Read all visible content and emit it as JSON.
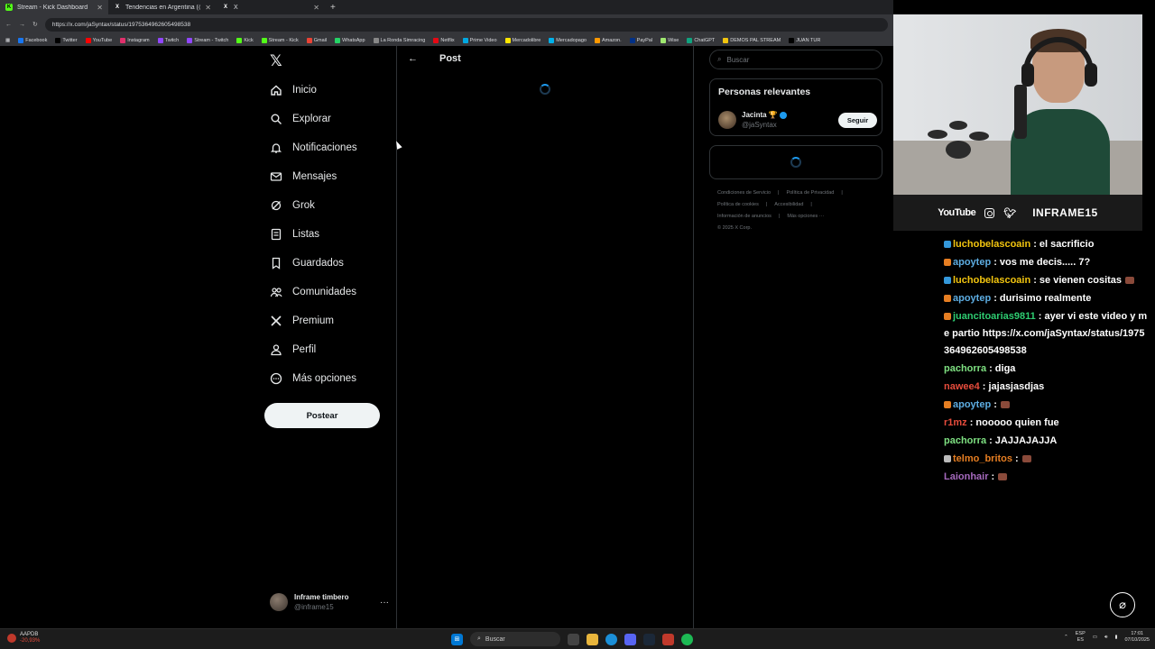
{
  "browser": {
    "tabs": [
      {
        "title": "Stream - Kick Dashboard",
        "fav_color": "#53fc18",
        "fav_glyph": "K"
      },
      {
        "title": "Tendencias en Argentina (@porq",
        "fav_color": "#000000",
        "fav_glyph": "X"
      },
      {
        "title": "X",
        "fav_color": "#000000",
        "fav_glyph": "X"
      }
    ],
    "url": "https://x.com/jaSyntax/status/1975364962605498538",
    "bookmarks": [
      {
        "label": "Facebook",
        "color": "#1877f2"
      },
      {
        "label": "Twitter",
        "color": "#000000"
      },
      {
        "label": "YouTube",
        "color": "#ff0000"
      },
      {
        "label": "Instagram",
        "color": "#e1306c"
      },
      {
        "label": "Twitch",
        "color": "#9146ff"
      },
      {
        "label": "Stream - Twitch",
        "color": "#9146ff"
      },
      {
        "label": "Kick",
        "color": "#53fc18"
      },
      {
        "label": "Stream - Kick",
        "color": "#53fc18"
      },
      {
        "label": "Gmail",
        "color": "#ea4335"
      },
      {
        "label": "WhatsApp",
        "color": "#25d366"
      },
      {
        "label": "La Ronda Simracing",
        "color": "#888888"
      },
      {
        "label": "Netflix",
        "color": "#e50914"
      },
      {
        "label": "Prime Video",
        "color": "#00a8e1"
      },
      {
        "label": "Mercadolibre",
        "color": "#ffe600"
      },
      {
        "label": "Mercadopago",
        "color": "#00b1ea"
      },
      {
        "label": "Amazon.",
        "color": "#ff9900"
      },
      {
        "label": "PayPal",
        "color": "#003087"
      },
      {
        "label": "Wise",
        "color": "#9fe870"
      },
      {
        "label": "ChatGPT",
        "color": "#10a37f"
      },
      {
        "label": "DEMOS PAL STREAM",
        "color": "#f1c40f"
      },
      {
        "label": "JUAN TUR",
        "color": "#000000"
      }
    ]
  },
  "x": {
    "logo": "𝕏",
    "nav": [
      {
        "label": "Inicio",
        "icon": "home-icon"
      },
      {
        "label": "Explorar",
        "icon": "search-icon"
      },
      {
        "label": "Notificaciones",
        "icon": "bell-icon"
      },
      {
        "label": "Mensajes",
        "icon": "mail-icon"
      },
      {
        "label": "Grok",
        "icon": "grok-icon"
      },
      {
        "label": "Listas",
        "icon": "list-icon"
      },
      {
        "label": "Guardados",
        "icon": "bookmark-icon"
      },
      {
        "label": "Comunidades",
        "icon": "communities-icon"
      },
      {
        "label": "Premium",
        "icon": "x-premium-icon"
      },
      {
        "label": "Perfil",
        "icon": "profile-icon"
      },
      {
        "label": "Más opciones",
        "icon": "more-icon"
      }
    ],
    "post_button": "Postear",
    "account": {
      "name": "Inframe timbero",
      "handle": "@inframe15",
      "more": "···"
    },
    "column": {
      "back": "←",
      "title": "Post"
    },
    "search_placeholder": "Buscar",
    "relevant": {
      "title": "Personas relevantes",
      "name": "Jacinta 🏆",
      "handle": "@jaSyntax",
      "follow": "Seguir"
    },
    "footer": [
      "Condiciones de Servicio",
      "|",
      "Política de Privacidad",
      "|",
      "Política de cookies",
      "|",
      "Accesibilidad",
      "|",
      "Información de anuncios",
      "|",
      "Más opciones ···",
      "© 2025 X Corp."
    ]
  },
  "overlay": {
    "social_youtube": "YouTube",
    "social_brand": "INFRAME15",
    "chat": [
      {
        "user": "luchobelascoain",
        "color": "#f1c40f",
        "badge": "#3498db",
        "text": ": el sacrificio",
        "emote": false
      },
      {
        "user": "apoytep",
        "color": "#5dade2",
        "badge": "#e67e22",
        "text": ": vos me decis..... 7?",
        "emote": false
      },
      {
        "user": "luchobelascoain",
        "color": "#f1c40f",
        "badge": "#3498db",
        "text": ": se vienen cositas",
        "emote": true
      },
      {
        "user": "apoytep",
        "color": "#5dade2",
        "badge": "#e67e22",
        "text": ": durisimo realmente",
        "emote": false
      },
      {
        "user": "juancitoarias9811",
        "color": "#2ecc71",
        "badge": "#e67e22",
        "text": ": ayer vi este video y me partio https://x.com/jaSyntax/status/1975364962605498538",
        "emote": false
      },
      {
        "user": "pachorra",
        "color": "#7ee081",
        "badge": "",
        "text": ": diga",
        "emote": false
      },
      {
        "user": "nawee4",
        "color": "#e74c3c",
        "badge": "",
        "text": ": jajasjasdjas",
        "emote": false
      },
      {
        "user": "apoytep",
        "color": "#5dade2",
        "badge": "#e67e22",
        "text": ":",
        "emote": true
      },
      {
        "user": "r1mz",
        "color": "#e74c3c",
        "badge": "",
        "text": ": nooooo quien fue",
        "emote": false
      },
      {
        "user": "pachorra",
        "color": "#7ee081",
        "badge": "",
        "text": ": JAJJAJAJJA",
        "emote": false
      },
      {
        "user": "telmo_britos",
        "color": "#e67e22",
        "badge": "#bbbbbb",
        "text": ":",
        "emote": true
      },
      {
        "user": "Laionhair",
        "color": "#a569bd",
        "badge": "",
        "text": ":",
        "emote": true
      }
    ]
  },
  "taskbar": {
    "stock_name": "AAPDB",
    "stock_change": "-20,93%",
    "search": "Buscar",
    "lang_top": "ESP",
    "lang_bottom": "ES",
    "time": "17:01",
    "date": "07/10/2025"
  }
}
